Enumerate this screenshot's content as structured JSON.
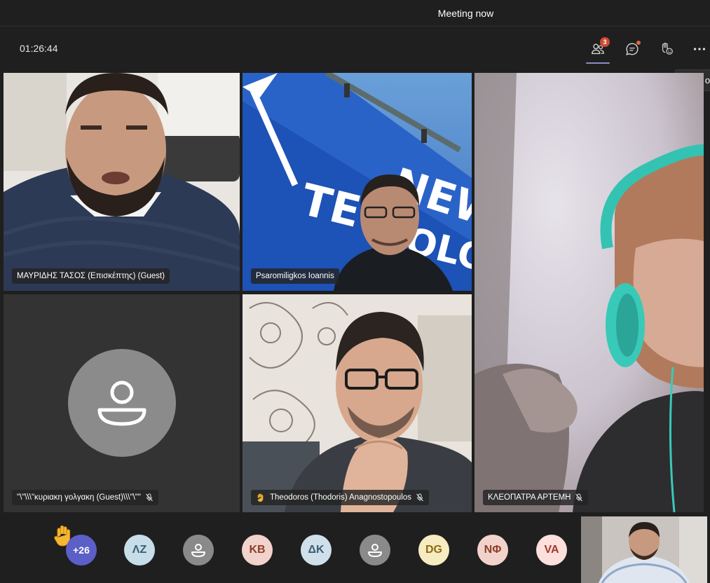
{
  "window": {
    "title": "Meeting now"
  },
  "toolbar": {
    "timer": "01:26:44",
    "participants_count": "3",
    "tooltip": "Turn o"
  },
  "tiles": [
    {
      "name": "ΜΑΥΡΙΔΗΣ ΤΑΣΟΣ (Επισκέπτης) (Guest)"
    },
    {
      "name": "Psaromiligkos Ioannis"
    },
    {
      "name": "\"\\\"\\\\\\\"κυριακη γολγακη (Guest)\\\\\\\"\\\"\""
    },
    {
      "name": "Theodoros (Thodoris) Anagnostopoulos"
    },
    {
      "name": "ΚΛΕΟΠΑΤΡΑ ΑΡΤΕΜΗ"
    }
  ],
  "background_sign": {
    "line1": "NEW",
    "line2": "TEC",
    "line3": "OLOG"
  },
  "roster": {
    "overflow": "+26",
    "avatars": [
      {
        "initials": "ΛΖ",
        "bg": "#c7dde9",
        "fg": "#3b5f73"
      },
      {
        "initials": "",
        "bg": "#8a8a8a",
        "fg": "#ffffff",
        "icon": "person-icon"
      },
      {
        "initials": "KB",
        "bg": "#f2d3cb",
        "fg": "#8f3d2a"
      },
      {
        "initials": "ΔΚ",
        "bg": "#cfe0ea",
        "fg": "#3b5f73"
      },
      {
        "initials": "",
        "bg": "#8a8a8a",
        "fg": "#ffffff",
        "icon": "person-icon"
      },
      {
        "initials": "DG",
        "bg": "#f7ebc1",
        "fg": "#8a6b14"
      },
      {
        "initials": "ΝΦ",
        "bg": "#f2d3cb",
        "fg": "#8f3d2a"
      },
      {
        "initials": "VA",
        "bg": "#fbe0dc",
        "fg": "#a5372f"
      }
    ]
  }
}
